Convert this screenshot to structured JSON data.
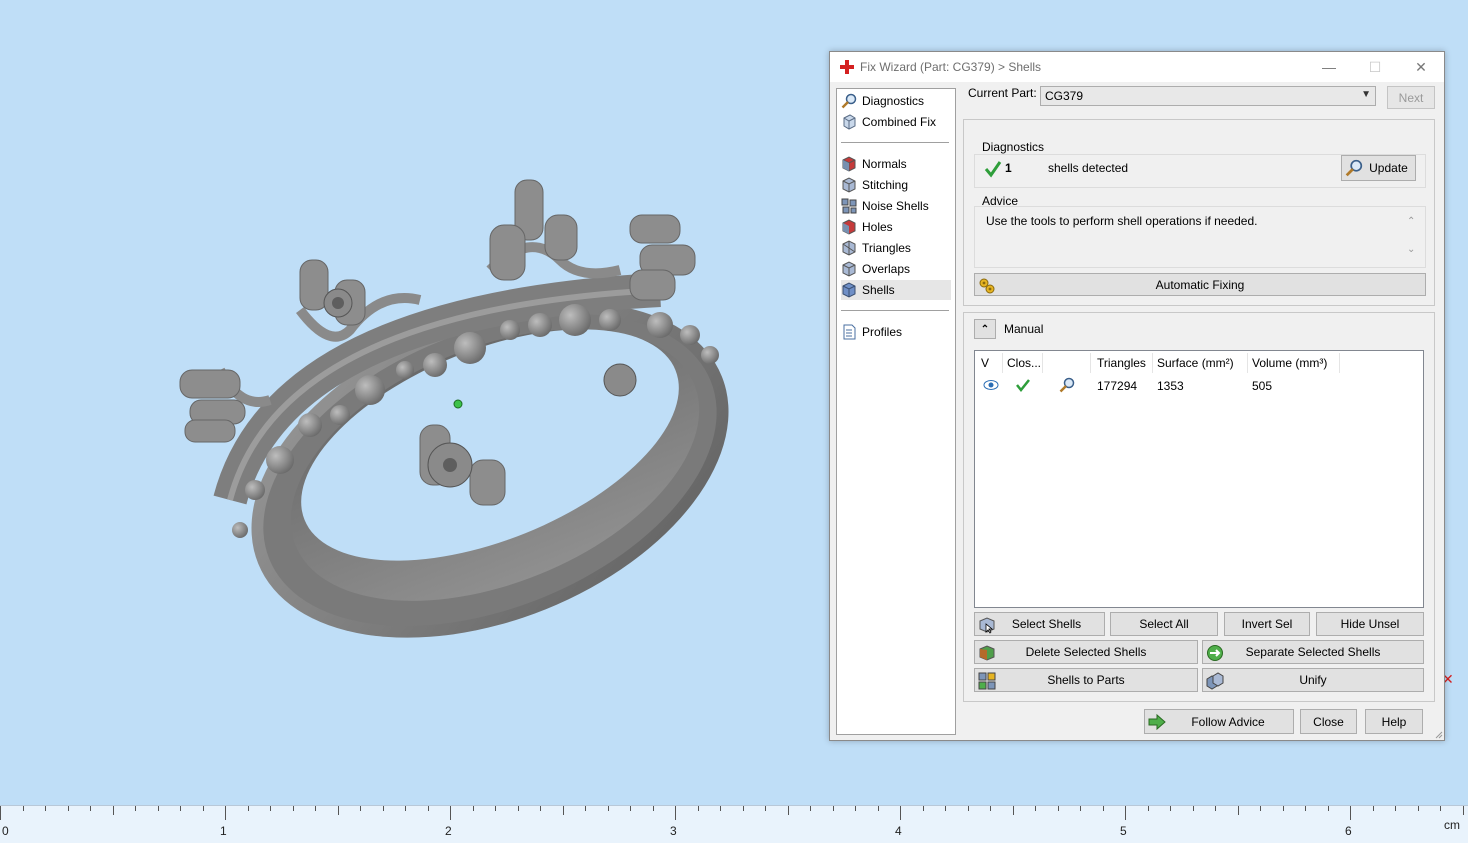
{
  "window": {
    "title": "Fix Wizard (Part: CG379) > Shells",
    "minimize": "—",
    "maximize": "☐",
    "close": "✕"
  },
  "nav": {
    "top": [
      {
        "label": "Diagnostics",
        "icon": "magnifier-icon"
      },
      {
        "label": "Combined Fix",
        "icon": "cube-icon"
      }
    ],
    "tools": [
      {
        "label": "Normals",
        "icon": "normals-icon"
      },
      {
        "label": "Stitching",
        "icon": "stitching-icon"
      },
      {
        "label": "Noise Shells",
        "icon": "noise-shells-icon"
      },
      {
        "label": "Holes",
        "icon": "holes-icon"
      },
      {
        "label": "Triangles",
        "icon": "triangles-icon"
      },
      {
        "label": "Overlaps",
        "icon": "overlaps-icon"
      },
      {
        "label": "Shells",
        "icon": "shells-icon"
      }
    ],
    "bottom": [
      {
        "label": "Profiles",
        "icon": "profiles-icon"
      }
    ],
    "active": "Shells"
  },
  "current_part": {
    "label": "Current Part:",
    "value": "CG379",
    "next_label": "Next"
  },
  "diagnostics": {
    "legend": "Diagnostics",
    "count": "1",
    "text": "shells detected",
    "update_label": "Update"
  },
  "advice": {
    "legend": "Advice",
    "text": "Use the tools to perform shell operations if needed."
  },
  "automatic_fixing_label": "Automatic Fixing",
  "manual": {
    "label": "Manual",
    "columns": [
      "V",
      "Clos...",
      "",
      "Triangles",
      "Surface (mm²)",
      "Volume (mm³)"
    ],
    "rows": [
      {
        "triangles": "177294",
        "surface": "1353",
        "volume": "505"
      }
    ]
  },
  "buttons": {
    "select_shells": "Select Shells",
    "select_all": "Select All",
    "invert_sel": "Invert Sel",
    "hide_unsel": "Hide Unsel",
    "delete_selected": "Delete Selected Shells",
    "separate_selected": "Separate Selected Shells",
    "shells_to_parts": "Shells to Parts",
    "unify": "Unify",
    "follow_advice": "Follow Advice",
    "close": "Close",
    "help": "Help"
  },
  "ruler": {
    "labels": [
      "0",
      "1",
      "2",
      "3",
      "4",
      "5",
      "6"
    ],
    "unit": "cm"
  },
  "colors": {
    "viewport_bg": "#bfdef7",
    "model": "#8c8c8c",
    "accent_green": "#2e9e3a",
    "red_cross": "#d42020"
  }
}
